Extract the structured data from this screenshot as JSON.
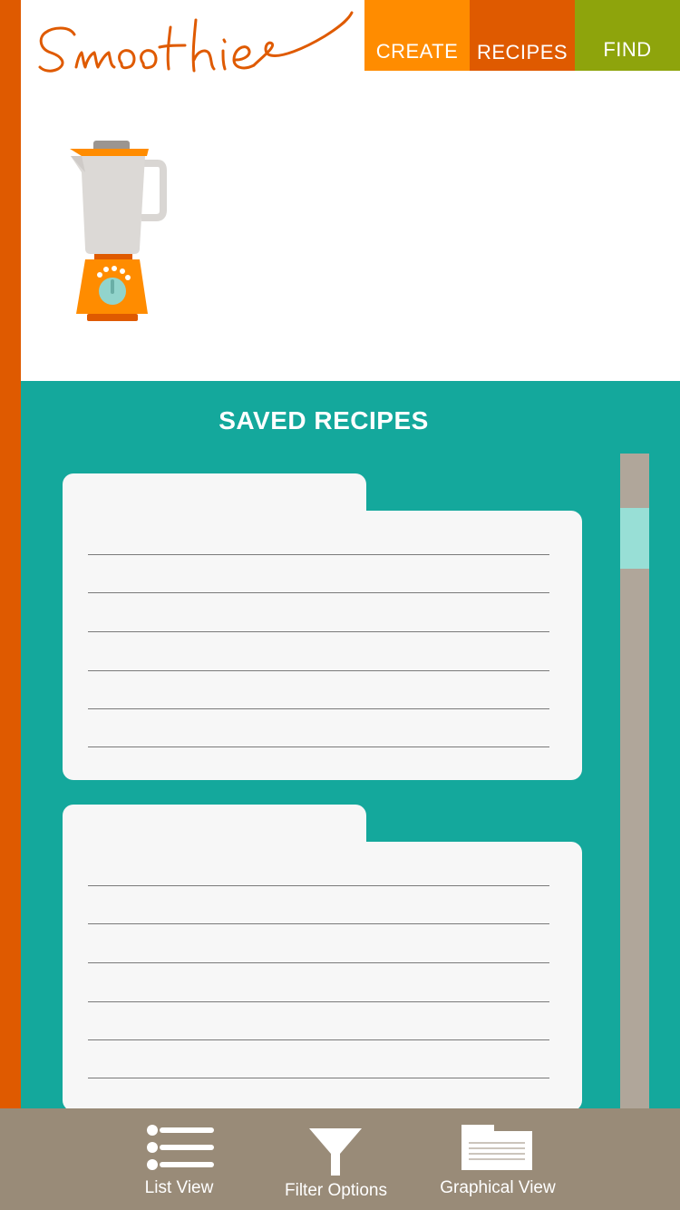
{
  "header": {
    "logo_text": "Smoothies",
    "tabs": [
      {
        "label": "CREATE",
        "color": "#ff8c00"
      },
      {
        "label": "RECIPES",
        "color": "#df5a00"
      },
      {
        "label": "FIND",
        "color": "#8ea40c"
      }
    ]
  },
  "saved_recipes": {
    "title": "SAVED RECIPES"
  },
  "bottom_nav": {
    "items": [
      {
        "label": "List View",
        "icon": "list-icon"
      },
      {
        "label": "Filter Options",
        "icon": "funnel-icon"
      },
      {
        "label": "Graphical View",
        "icon": "folder-icon"
      }
    ]
  },
  "colors": {
    "orange_accent": "#df5a00",
    "teal_panel": "#14a89c",
    "bottom_bar": "#998b78",
    "scroll_thumb": "#98dfd6"
  }
}
